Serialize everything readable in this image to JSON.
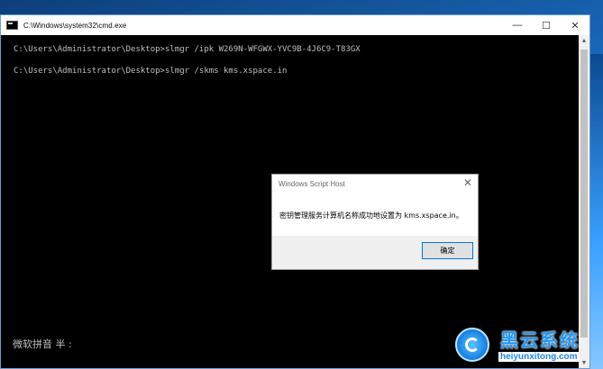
{
  "window": {
    "title": "C:\\Windows\\system32\\cmd.exe",
    "controls": {
      "minimize": "—",
      "maximize": "☐",
      "close": "✕"
    }
  },
  "console": {
    "lines": [
      "C:\\Users\\Administrator\\Desktop>slmgr /ipk W269N-WFGWX-YVC9B-4J6C9-T83GX",
      "C:\\Users\\Administrator\\Desktop>slmgr /skms kms.xspace.in"
    ],
    "ime_status": "微软拼音 半 :"
  },
  "dialog": {
    "title": "Windows Script Host",
    "message": "密钥管理服务计算机名称成功地设置为 kms.xspace.in。",
    "ok_label": "确定"
  },
  "watermark": {
    "cn": "黑云系统",
    "en": "heiyunxitong.com"
  }
}
